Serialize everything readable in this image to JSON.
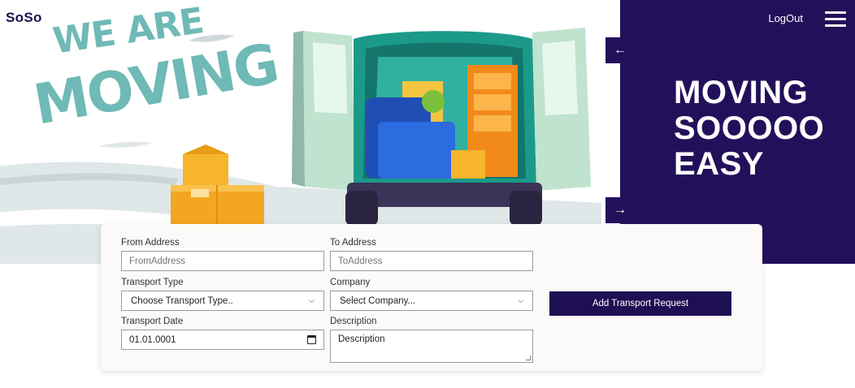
{
  "brand": {
    "logo": "SoSo"
  },
  "hero": {
    "slogan_line1": "WE ARE",
    "slogan_line2": "MOVING"
  },
  "panel": {
    "logout_label": "LogOut",
    "headline": [
      "MOVING",
      "SOOOOO",
      "EASY"
    ],
    "prev_arrow": "←",
    "next_arrow": "→"
  },
  "form": {
    "from_address": {
      "label": "From Address",
      "placeholder": "FromAddress"
    },
    "to_address": {
      "label": "To Address",
      "placeholder": "ToAddress"
    },
    "transport_type": {
      "label": "Transport Type",
      "selected": "Choose Transport Type.."
    },
    "company": {
      "label": "Company",
      "selected": "Select Company..."
    },
    "transport_date": {
      "label": "Transport Date",
      "value": "01.01.0001"
    },
    "description": {
      "label": "Description",
      "placeholder": "Description"
    },
    "submit_label": "Add Transport Request"
  },
  "colors": {
    "primary": "#22115a",
    "slogan": "#6fb9b6",
    "card_bg": "#fbfaf8"
  },
  "icons": [
    "hamburger-menu-icon",
    "arrow-left-icon",
    "arrow-right-icon",
    "chevron-down-icon",
    "calendar-icon"
  ]
}
